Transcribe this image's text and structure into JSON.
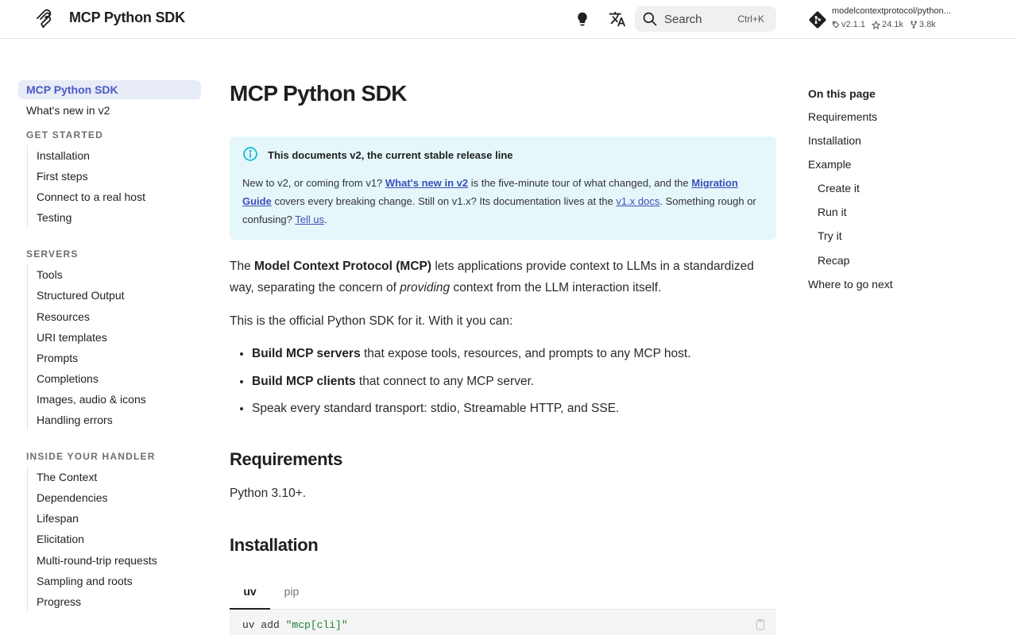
{
  "header": {
    "site_title": "MCP Python SDK",
    "icons": [
      "logo-icon",
      "lightbulb-icon",
      "translate-icon",
      "search-icon",
      "git-icon"
    ],
    "search": {
      "label": "Search",
      "shortcut": "Ctrl+K"
    },
    "repo": {
      "name": "modelcontextprotocol/python...",
      "version": "v2.1.1",
      "stars": "24.1k",
      "forks": "3.8k"
    }
  },
  "sidebar": {
    "top": [
      {
        "label": "MCP Python SDK",
        "active": true
      },
      {
        "label": "What's new in v2",
        "active": false
      }
    ],
    "sections": [
      {
        "title": "GET STARTED",
        "items": [
          "Installation",
          "First steps",
          "Connect to a real host",
          "Testing"
        ]
      },
      {
        "title": "SERVERS",
        "items": [
          "Tools",
          "Structured Output",
          "Resources",
          "URI templates",
          "Prompts",
          "Completions",
          "Images, audio & icons",
          "Handling errors"
        ]
      },
      {
        "title": "INSIDE YOUR HANDLER",
        "items": [
          "The Context",
          "Dependencies",
          "Lifespan",
          "Elicitation",
          "Multi-round-trip requests",
          "Sampling and roots",
          "Progress"
        ]
      }
    ]
  },
  "main": {
    "title": "MCP Python SDK",
    "admonition": {
      "title": "This documents v2, the current stable release line",
      "t1": "New to v2, or coming from v1? ",
      "link1": "What's new in v2",
      "t2": " is the five-minute tour of what changed, and the ",
      "link2": "Migration Guide",
      "t3": " covers every breaking change. Still on v1.x? Its documentation lives at the ",
      "link3": "v1.x docs",
      "t4": ". Something rough or confusing? ",
      "link4": "Tell us",
      "t5": "."
    },
    "intro": {
      "t1": "The ",
      "bold": "Model Context Protocol (MCP)",
      "t2": " lets applications provide context to LLMs in a standardized way, separating the concern of ",
      "em": "providing",
      "t3": " context from the LLM interaction itself."
    },
    "official": "This is the official Python SDK for it. With it you can:",
    "bullets": [
      {
        "bold": "Build MCP servers",
        "text": " that expose tools, resources, and prompts to any MCP host."
      },
      {
        "bold": "Build MCP clients",
        "text": " that connect to any MCP server."
      },
      {
        "bold": "",
        "text": "Speak every standard transport: stdio, Streamable HTTP, and SSE."
      }
    ],
    "requirements_heading": "Requirements",
    "requirements_text": "Python 3.10+.",
    "installation_heading": "Installation",
    "tabs": [
      "uv",
      "pip"
    ],
    "code": {
      "cmd": "uv add ",
      "arg": "\"mcp[cli]\""
    }
  },
  "toc": {
    "title": "On this page",
    "items": [
      {
        "label": "Requirements",
        "sub": false
      },
      {
        "label": "Installation",
        "sub": false
      },
      {
        "label": "Example",
        "sub": false
      },
      {
        "label": "Create it",
        "sub": true
      },
      {
        "label": "Run it",
        "sub": true
      },
      {
        "label": "Try it",
        "sub": true
      },
      {
        "label": "Recap",
        "sub": true
      },
      {
        "label": "Where to go next",
        "sub": false
      }
    ]
  },
  "colors": {
    "accent": "#4a5ac2",
    "link": "#3d4fb8",
    "admonition_bg": "#e5f7fb",
    "admonition_icon": "#00b8d4"
  }
}
